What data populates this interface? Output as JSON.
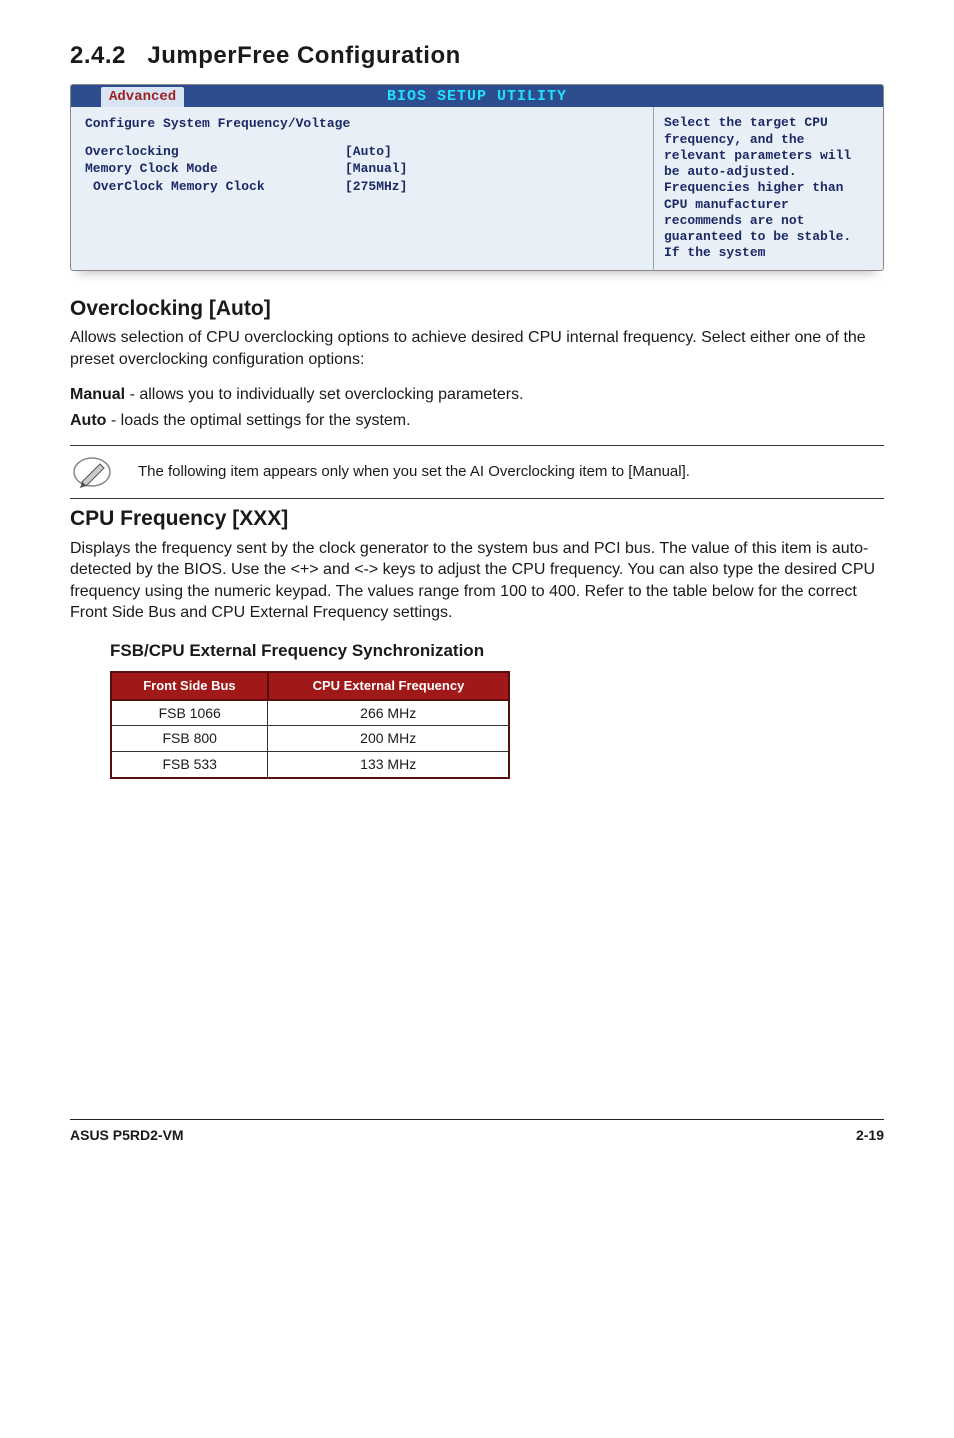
{
  "section": {
    "number": "2.4.2",
    "title": "JumperFree Configuration"
  },
  "bios": {
    "header": "BIOS SETUP UTILITY",
    "tab": "Advanced",
    "left_title": "Configure System Frequency/Voltage",
    "rows": [
      {
        "label": "Overclocking",
        "value": "[Auto]",
        "indent": false
      },
      {
        "label": "Memory Clock Mode",
        "value": "[Manual]",
        "indent": false
      },
      {
        "label": "OverClock Memory Clock",
        "value": "[275MHz]",
        "indent": true
      }
    ],
    "help": "Select the target CPU frequency, and the relevant parameters will be auto-adjusted. Frequencies higher than CPU manufacturer recommends are not guaranteed to be stable. If the system"
  },
  "overclocking": {
    "heading": "Overclocking [Auto]",
    "para": "Allows selection of CPU overclocking options to achieve desired CPU internal frequency. Select either one of the preset overclocking configuration options:",
    "manual_label": "Manual",
    "manual_text": " - allows you to individually set overclocking parameters.",
    "auto_label": "Auto",
    "auto_text": " - loads the optimal settings for the system."
  },
  "note": "The following item appears only when you set the AI Overclocking item to [Manual].",
  "cpu_freq": {
    "heading": "CPU Frequency [XXX]",
    "para": "Displays the frequency sent by the clock generator to the system bus and PCI bus. The value of this item is auto-detected by the BIOS. Use the <+> and <-> keys to adjust the CPU frequency. You can also type the desired CPU frequency using the numeric keypad. The values range from 100 to 400. Refer to the table below for the correct Front Side Bus and CPU External Frequency settings."
  },
  "fsb_table": {
    "heading": "FSB/CPU External Frequency Synchronization",
    "headers": [
      "Front Side Bus",
      "CPU External Frequency"
    ],
    "rows": [
      [
        "FSB 1066",
        "266 MHz"
      ],
      [
        "FSB 800",
        "200 MHz"
      ],
      [
        "FSB 533",
        "133 MHz"
      ]
    ]
  },
  "footer": {
    "left": "ASUS P5RD2-VM",
    "right": "2-19"
  }
}
